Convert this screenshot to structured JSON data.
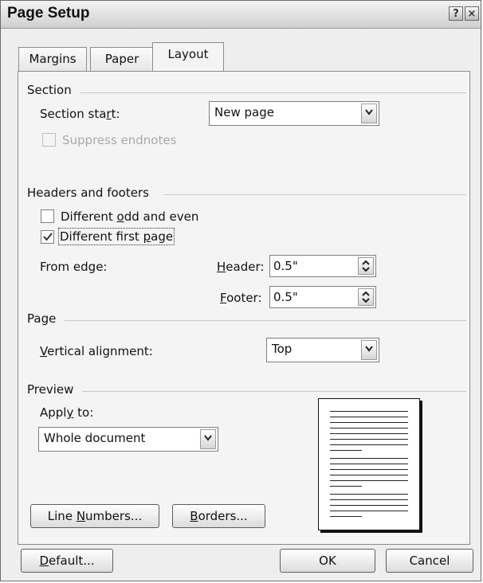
{
  "window": {
    "title": "Page Setup",
    "help_glyph": "?",
    "close_glyph": "×"
  },
  "tabs": [
    {
      "label": "Margins",
      "active": false
    },
    {
      "label": "Paper",
      "active": false
    },
    {
      "label": "Layout",
      "active": true
    }
  ],
  "section": {
    "group_label": "Section",
    "start_label": "Section start:",
    "start_value": "New page",
    "suppress_label": "Suppress endnotes",
    "suppress_checked": false,
    "suppress_enabled": false
  },
  "headers_footers": {
    "group_label": "Headers and footers",
    "odd_even_label": "Different odd and even",
    "odd_even_checked": false,
    "first_page_label": "Different first page",
    "first_page_checked": true,
    "from_edge_label": "From edge:",
    "header_label": "Header:",
    "header_value": "0.5\"",
    "footer_label": "Footer:",
    "footer_value": "0.5\""
  },
  "page": {
    "group_label": "Page",
    "vertical_alignment_label": "Vertical alignment:",
    "vertical_alignment_value": "Top"
  },
  "preview": {
    "group_label": "Preview",
    "apply_to_label": "Apply to:",
    "apply_to_value": "Whole document"
  },
  "buttons": {
    "line_numbers": "Line Numbers...",
    "borders": "Borders...",
    "default": "Default...",
    "ok": "OK",
    "cancel": "Cancel"
  }
}
